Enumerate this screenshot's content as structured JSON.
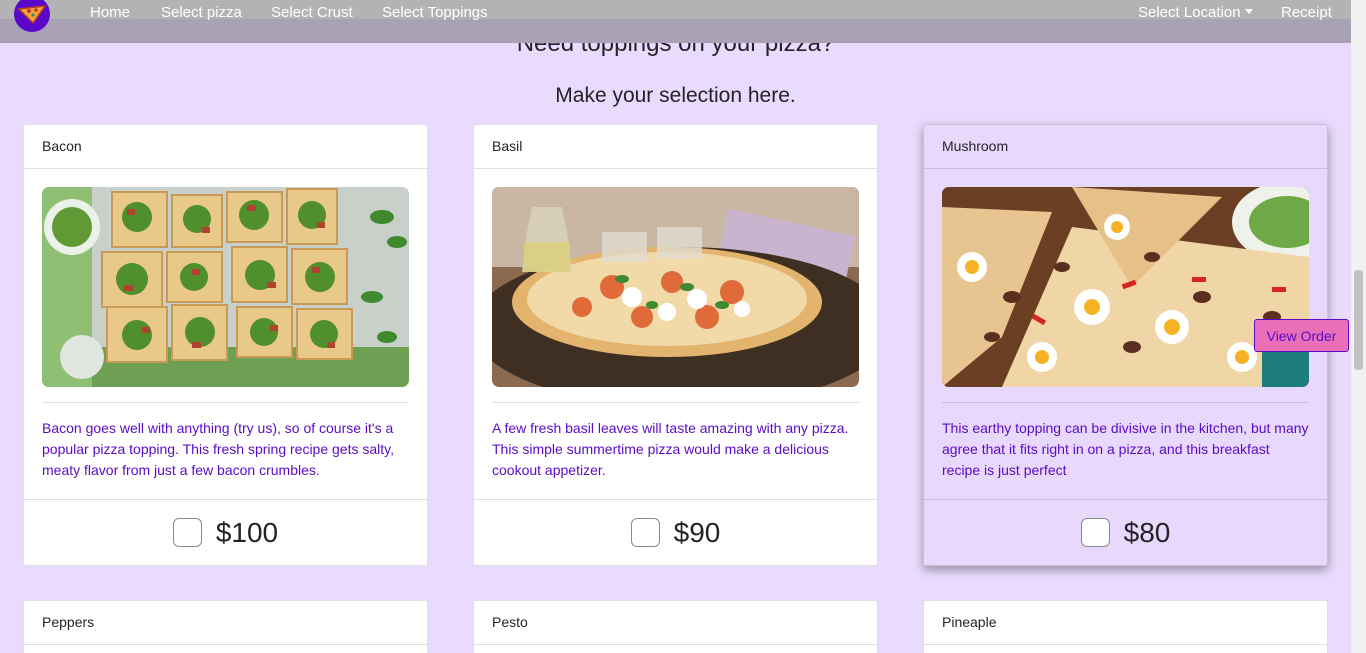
{
  "nav": {
    "logo_icon": "pizza-slice-icon",
    "home": "Home",
    "select_pizza": "Select pizza",
    "select_crust": "Select Crust",
    "select_toppings": "Select Toppings",
    "select_location": "Select Location",
    "receipt": "Receipt"
  },
  "heading": "Need toppings on your pizza?",
  "subheading": "Make your selection here.",
  "toppings": [
    {
      "name": "Bacon",
      "description": "Bacon goes well with anything (try us), so of course it's a popular pizza topping. This fresh spring recipe gets salty, meaty flavor from just a few bacon crumbles.",
      "price": "$100",
      "checked": false
    },
    {
      "name": "Basil",
      "description": "A few fresh basil leaves will taste amazing with any pizza. This simple summertime pizza would make a delicious cookout appetizer.",
      "price": "$90",
      "checked": false
    },
    {
      "name": "Mushroom",
      "description": "This earthy topping can be divisive in the kitchen, but many agree that it fits right in on a pizza, and this breakfast recipe is just perfect",
      "price": "$80",
      "checked": false
    },
    {
      "name": "Peppers"
    },
    {
      "name": "Pesto"
    },
    {
      "name": "Pineaple"
    }
  ],
  "view_order": "View Order",
  "colors": {
    "page_background": "#e9dbfd",
    "navbar": "#a9a2b5",
    "accent_purple": "#5b0bc6",
    "view_order_button": "#e86fb8",
    "active_card": "#e8d8fc"
  }
}
